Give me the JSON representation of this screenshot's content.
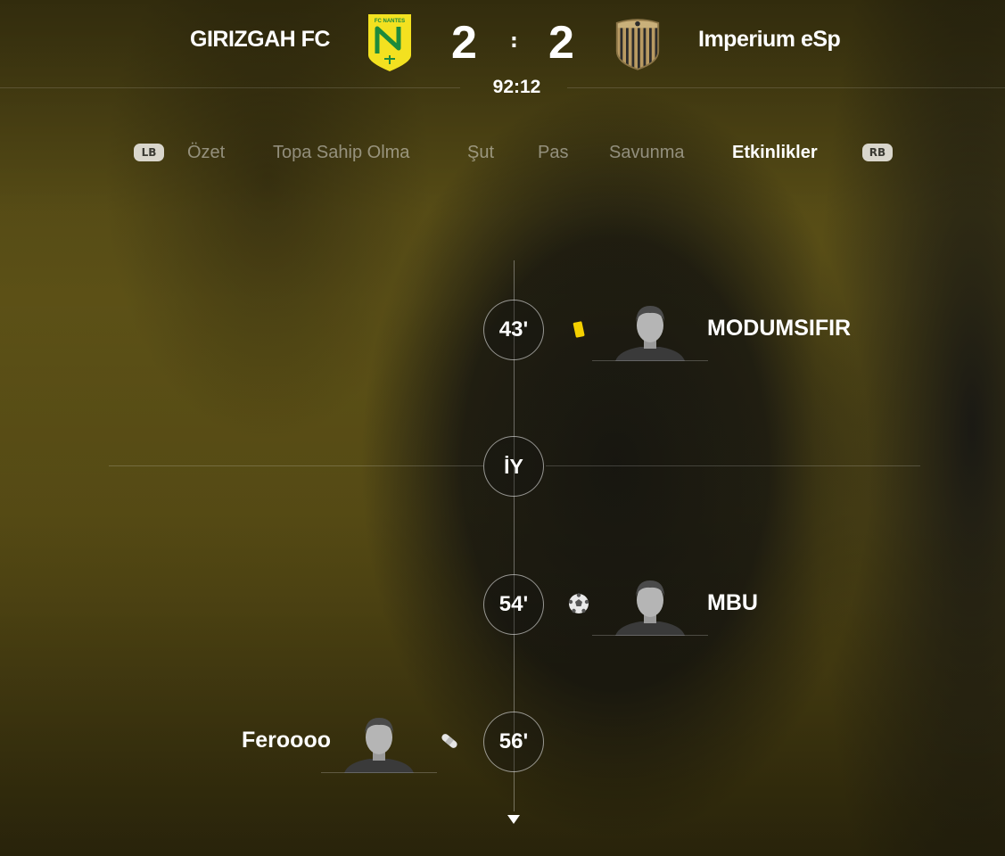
{
  "header": {
    "home_team": "GIRIZGAH FC",
    "away_team": "Imperium eSp",
    "home_crest_icon": "fc-nantes-crest-icon",
    "home_crest_text": "FC NANTES",
    "away_crest_icon": "striped-shield-crest-icon",
    "home_score": "2",
    "separator": ":",
    "away_score": "2",
    "clock": "92:12"
  },
  "tabs": {
    "left_shoulder": "LB",
    "right_shoulder": "RB",
    "items": [
      "Özet",
      "Topa Sahip Olma",
      "Şut",
      "Pas",
      "Savunma",
      "Etkinlikler"
    ],
    "active": "Etkinlikler"
  },
  "timeline": {
    "events": [
      {
        "minute": "43'",
        "team": "away",
        "type": "yellow-card-icon",
        "player": "MODUMSIFIR"
      },
      {
        "minute": "54'",
        "team": "away",
        "type": "goal-ball-icon",
        "player": "MBU"
      },
      {
        "minute": "56'",
        "team": "home",
        "type": "injury-bandage-icon",
        "player": "Feroooo"
      }
    ],
    "halftime_label": "İY",
    "more_icon": "chevron-down-icon"
  },
  "colors": {
    "nantes_yellow": "#f3e120",
    "nantes_green": "#1d8a3c",
    "yellow_card": "#f4d000",
    "away_crest_gold": "#b89a62",
    "away_crest_dark": "#2b2b2b"
  }
}
